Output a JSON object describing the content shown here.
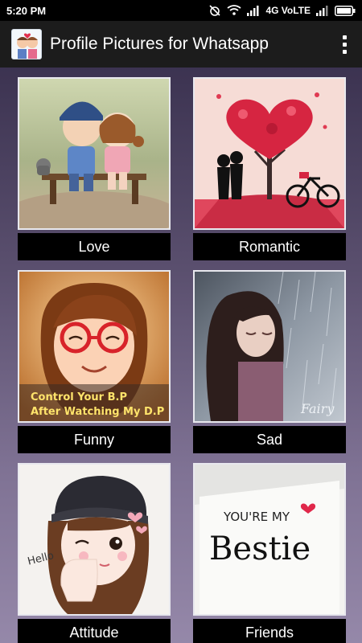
{
  "status_bar": {
    "time": "5:20 PM",
    "network": "4G VoLTE",
    "icons": [
      "alarm-off-icon",
      "wifi-icon",
      "signal-icon",
      "signal-icon-2",
      "battery-icon"
    ]
  },
  "app_bar": {
    "title": "Profile Pictures for Whatsapp",
    "overflow_icon": "more-vert-icon"
  },
  "categories": [
    {
      "label": "Love"
    },
    {
      "label": "Romantic"
    },
    {
      "label": "Funny",
      "thumb_text_line1": "Control Your B.P",
      "thumb_text_line2": "After Watching My D.P"
    },
    {
      "label": "Sad",
      "thumb_text": "Fairy"
    },
    {
      "label": "Attitude",
      "thumb_text": "Hello"
    },
    {
      "label": "Friends",
      "thumb_text_line1": "YOU'RE MY",
      "thumb_text_line2": "Bestie"
    }
  ]
}
